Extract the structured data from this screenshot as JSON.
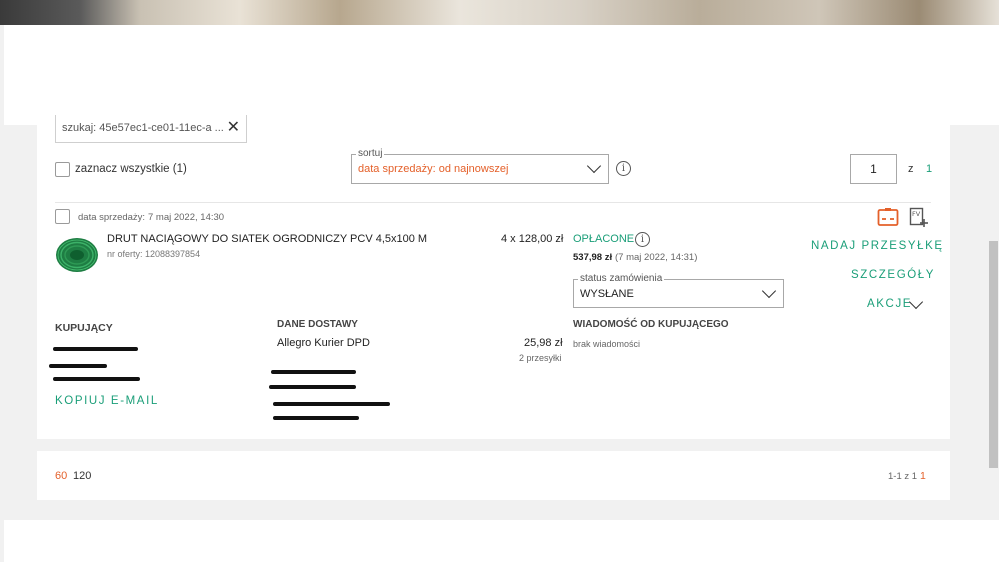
{
  "search": {
    "text": "szukaj: 45e57ec1-ce01-11ec-a ..."
  },
  "toolbar": {
    "select_all_label": "zaznacz wszystkie (1)",
    "sort_legend": "sortuj",
    "sort_value": "data sprzedaży: od najnowszej",
    "page_current": "1",
    "page_of_label": "z",
    "page_total": "1"
  },
  "order": {
    "sale_date_label": "data sprzedaży:",
    "sale_date": "7 maj 2022, 14:30",
    "product_name": "DRUT NACIĄGOWY DO SIATEK OGRODNICZY PCV 4,5x100 M",
    "offer_number": "nr oferty: 12088397854",
    "quantity_price": "4 x 128,00 zł",
    "payment_status": "OPŁACONE",
    "total": "537,98 zł",
    "total_date": "(7 maj 2022, 14:31)",
    "status_legend": "status zamówienia",
    "status_value": "WYSŁANE",
    "actions": {
      "ship": "NADAJ PRZESYŁKĘ",
      "details": "SZCZEGÓŁY",
      "more": "AKCJE"
    },
    "buyer_heading": "KUPUJĄCY",
    "copy_email": "KOPIUJ E-MAIL",
    "delivery_heading": "DANE DOSTAWY",
    "delivery_method": "Allegro Kurier DPD",
    "delivery_price": "25,98 zł",
    "packages": "2 przesyłki",
    "message_heading": "WIADOMOŚĆ OD KUPUJĄCEGO",
    "message": "brak wiadomości"
  },
  "footer": {
    "page_size_selected": "60",
    "page_size_other": "120",
    "range": "1-1 z 1",
    "current_page": "1"
  },
  "colors": {
    "accent_orange": "#e4602a",
    "accent_green": "#1a9e78",
    "page_bg": "#f1f1f1"
  },
  "icons": [
    "close-icon",
    "chevron-down-icon",
    "info-icon",
    "shipping-label-icon",
    "invoice-add-icon",
    "product-thumbnail"
  ]
}
